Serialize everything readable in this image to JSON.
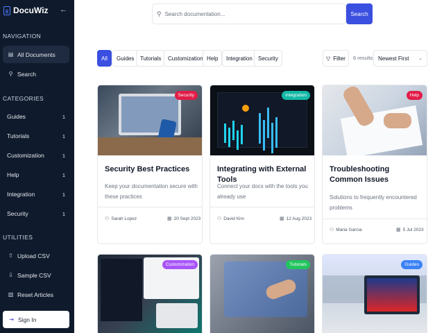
{
  "sidebar": {
    "brand": "DocuWiz",
    "collapse_icon": "arrow-left-icon",
    "nav_label": "NAVIGATION",
    "nav": [
      {
        "label": "All Documents",
        "icon": "document-icon",
        "active": true
      },
      {
        "label": "Search",
        "icon": "search-icon",
        "active": false
      }
    ],
    "categories_label": "CATEGORIES",
    "categories": [
      {
        "label": "Guides",
        "count": "1"
      },
      {
        "label": "Tutorials",
        "count": "1"
      },
      {
        "label": "Customization",
        "count": "1"
      },
      {
        "label": "Help",
        "count": "1"
      },
      {
        "label": "Integration",
        "count": "1"
      },
      {
        "label": "Security",
        "count": "1"
      }
    ],
    "utilities_label": "UTILITIES",
    "utilities": [
      {
        "label": "Upload CSV",
        "icon": "upload-icon"
      },
      {
        "label": "Sample CSV",
        "icon": "download-icon"
      },
      {
        "label": "Reset Articles",
        "icon": "trash-icon"
      }
    ],
    "signin": "Sign In"
  },
  "search": {
    "placeholder": "Search documentation...",
    "button": "Search"
  },
  "filters": {
    "chips": [
      "All",
      "Guides",
      "Tutorials",
      "Customization",
      "Help",
      "Integration",
      "Security"
    ],
    "active": "All",
    "filter_label": "Filter",
    "results": "6 results",
    "sort": "Newest First"
  },
  "articles": [
    {
      "title": "Security Best Practices",
      "desc": "Keep your documentation secure with these practices",
      "author": "Sarah Lopez",
      "date": "20 Sept 2023",
      "badge": "Security",
      "badge_color": "#e11d48"
    },
    {
      "title": "Integrating with External Tools",
      "desc": "Connect your docs with the tools you already use",
      "author": "David Kim",
      "date": "12 Aug 2023",
      "badge": "Integration",
      "badge_color": "#14b8a6"
    },
    {
      "title": "Troubleshooting Common Issues",
      "desc": "Solutions to frequently encountered problems",
      "author": "Maria Garcia",
      "date": "5 Jul 2023",
      "badge": "Help",
      "badge_color": "#e11d48"
    },
    {
      "badge": "Customization",
      "badge_color": "#a855f7"
    },
    {
      "badge": "Tutorials",
      "badge_color": "#22c55e"
    },
    {
      "badge": "Guides",
      "badge_color": "#3b82f6"
    }
  ]
}
